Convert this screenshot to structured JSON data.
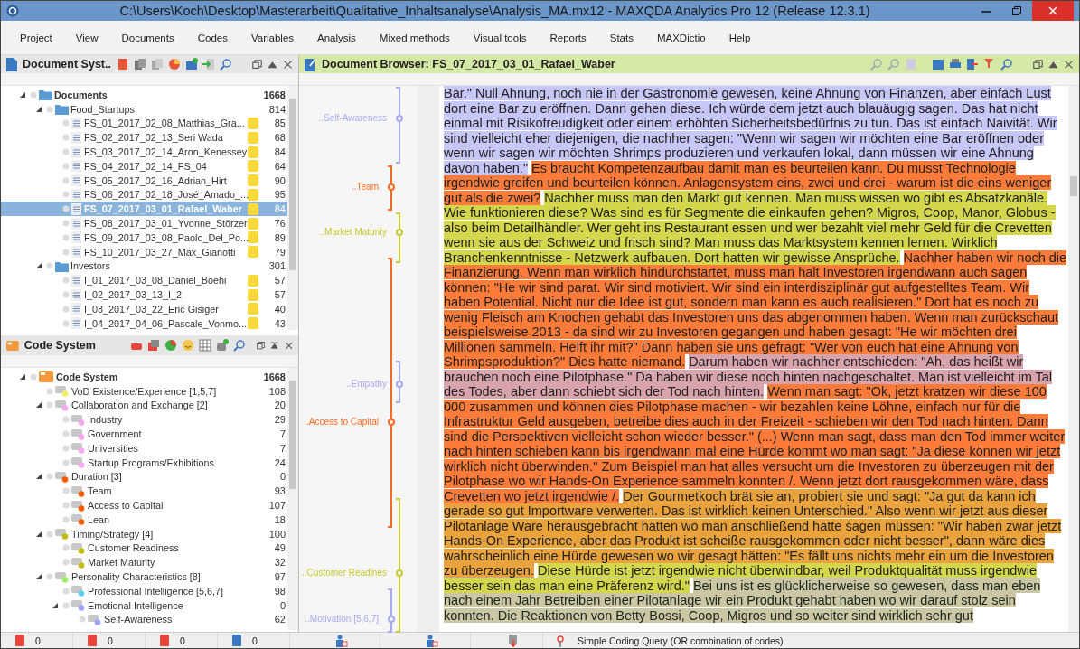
{
  "window": {
    "title": "C:\\Users\\Koch\\Desktop\\Masterarbeit\\Qualitative_Inhaltsanalyse\\Analysis_MA.mx12 - MAXQDA Analytics Pro 12  (Release 12.3.1)"
  },
  "menu": [
    "Project",
    "View",
    "Documents",
    "Codes",
    "Variables",
    "Analysis",
    "Mixed methods",
    "Visual tools",
    "Reports",
    "Stats",
    "MAXDictio",
    "Help"
  ],
  "document_system": {
    "title": "Document Syst..",
    "tree": [
      {
        "kind": "root",
        "label": "Documents",
        "count": "1668",
        "expanded": true,
        "selected": false,
        "children": [
          {
            "kind": "folder",
            "label": "Food_Startups",
            "count": "814",
            "expanded": true,
            "selected": false,
            "children": [
              {
                "kind": "document",
                "label": "FS_01_2017_02_08_Matthias_Gra...",
                "count": "85",
                "selected": false
              },
              {
                "kind": "document",
                "label": "FS_02_2017_02_13_Seri Wada",
                "count": "68",
                "selected": false
              },
              {
                "kind": "document",
                "label": "FS_03_2017_02_14_Aron_Kenessey",
                "count": "84",
                "selected": false
              },
              {
                "kind": "document",
                "label": "FS_04_2017_02_14_FS_04",
                "count": "64",
                "selected": false
              },
              {
                "kind": "document",
                "label": "FS_05_2017_02_16_Adrian_Hirt",
                "count": "90",
                "selected": false
              },
              {
                "kind": "document",
                "label": "FS_06_2017_02_18_José_Amado_...",
                "count": "95",
                "selected": false
              },
              {
                "kind": "document",
                "label": "FS_07_2017_03_01_Rafael_Waber",
                "count": "84",
                "selected": true
              },
              {
                "kind": "document",
                "label": "FS_08_2017_03_01_Yvonne_Störzer",
                "count": "76",
                "selected": false
              },
              {
                "kind": "document",
                "label": "FS_09_2017_03_08_Paolo_Del_Po...",
                "count": "89",
                "selected": false
              },
              {
                "kind": "document",
                "label": "FS_10_2017_03_27_Max_Gianotti",
                "count": "79",
                "selected": false
              }
            ]
          },
          {
            "kind": "folder",
            "label": "Investors",
            "count": "301",
            "expanded": true,
            "selected": false,
            "children": [
              {
                "kind": "document",
                "label": "I_01_2017_03_08_Daniel_Boehi",
                "count": "57",
                "selected": false
              },
              {
                "kind": "document",
                "label": "I_02_2017_03_13_I_2",
                "count": "57",
                "selected": false
              },
              {
                "kind": "document",
                "label": "I_03_2017_03_22_Eric Gisiger",
                "count": "40",
                "selected": false
              },
              {
                "kind": "document",
                "label": "I_04_2017_04_06_Pascale_Vonmo...",
                "count": "43",
                "selected": false
              }
            ]
          }
        ]
      }
    ]
  },
  "code_system": {
    "title": "Code System",
    "tree": [
      {
        "kind": "root",
        "label": "Code System",
        "count": "1668",
        "expanded": true,
        "children": [
          {
            "kind": "code",
            "label": "VoD Existence/Experience [1,5,7]",
            "count": "108",
            "color": "#f3ee70"
          },
          {
            "kind": "code",
            "label": "Collaboration and Exchange [2]",
            "count": "20",
            "color": "#f5a8ee",
            "expanded": true,
            "children": [
              {
                "kind": "code",
                "label": "Industry",
                "count": "29",
                "color": "#f5a8ee"
              },
              {
                "kind": "code",
                "label": "Government",
                "count": "7",
                "color": "#f5a8ee"
              },
              {
                "kind": "code",
                "label": "Universities",
                "count": "7",
                "color": "#f5a8ee"
              },
              {
                "kind": "code",
                "label": "Startup Programs/Exhibitions",
                "count": "24",
                "color": "#f5a8ee"
              }
            ]
          },
          {
            "kind": "code",
            "label": "Duration [3]",
            "count": "0",
            "color": "#ff5a00",
            "expanded": true,
            "children": [
              {
                "kind": "code",
                "label": "Team",
                "count": "93",
                "color": "#ff5a00"
              },
              {
                "kind": "code",
                "label": "Access to Capital",
                "count": "107",
                "color": "#ff5a00"
              },
              {
                "kind": "code",
                "label": "Lean",
                "count": "18",
                "color": "#ff5a00"
              }
            ]
          },
          {
            "kind": "code",
            "label": "Timing/Strategy [4]",
            "count": "100",
            "color": "#c4bc10",
            "expanded": true,
            "children": [
              {
                "kind": "code",
                "label": "Customer Readiness",
                "count": "49",
                "color": "#c4bc10"
              },
              {
                "kind": "code",
                "label": "Market Maturity",
                "count": "32",
                "color": "#c4bc10"
              }
            ]
          },
          {
            "kind": "code",
            "label": "Personality Characteristics [8]",
            "count": "97",
            "color": "#9cf070",
            "expanded": true,
            "children": [
              {
                "kind": "code",
                "label": "Professional Intelligence [5,6,7]",
                "count": "98",
                "color": "#5cd0f5"
              },
              {
                "kind": "code",
                "label": "Emotional Intelligence",
                "count": "0",
                "color": "#a0a0ff",
                "expanded": true,
                "children": [
                  {
                    "kind": "code",
                    "label": "Self-Awareness",
                    "count": "62",
                    "color": "#a0a0ff"
                  }
                ]
              }
            ]
          }
        ]
      }
    ]
  },
  "document_browser": {
    "title": "Document Browser: FS_07_2017_03_01_Rafael_Waber",
    "margin_codes": [
      {
        "label": "..Self-Awareness",
        "color": "#a8a8f0"
      },
      {
        "label": "..Team",
        "color": "#ff6a20"
      },
      {
        "label": "..Market Maturity",
        "color": "#c8c830"
      },
      {
        "label": "..Empathy",
        "color": "#a8a8f0"
      },
      {
        "label": "..Access to Capital",
        "color": "#ff6a20"
      },
      {
        "label": "..Customer Readines",
        "color": "#c8c830"
      },
      {
        "label": "..Motivation [5,6,7]",
        "color": "#a8a8f0"
      }
    ],
    "segments": [
      {
        "text": "Bar.\" Null Ahnung, noch nie in der Gastronomie gewesen, keine Ahnung von Finanzen, aber einfach Lust dort eine Bar zu eröffnen. Dann gehen diese. Ich würde dem jetzt auch blauäugig sagen. Das hat nicht einmal mit Risikofreudigkeit oder einem erhöhten Sicherheitsbedürfnis zu tun. Das ist einfach Naivität. Wir sind vielleicht eher diejenigen, die nachher sagen: \"Wenn wir sagen wir möchten eine Bar eröffnen oder wenn wir sagen wir möchten Shrimps produzieren und verkaufen lokal, dann müssen wir eine Ahnung davon haben.\"",
        "color": "#c6c6f7"
      },
      {
        "text": "Es braucht Kompetenzaufbau damit man es beurteilen kann. Du musst Technologie irgendwie greifen und beurteilen können. Anlagensystem eins, zwei und drei - warum ist die eins weniger gut als die zwei?",
        "color": "#ff7b3a"
      },
      {
        "text": "Nachher muss man den Markt gut kennen. Man muss wissen wo gibt es Absatzkanäle. Wie funktionieren diese? Was sind es für Segmente die einkaufen gehen? Migros, Coop, Manor, Globus - also beim Detailhändler. Wer geht ins Restaurant essen und wer bezahlt viel mehr Geld für die Crevetten wenn sie aus der Schweiz und frisch sind? Man muss das Marktsystem kennen lernen. Wirklich Branchenkenntnisse - Netzwerk aufbauen. Dort hatten wir gewisse Ansprüche.",
        "color": "#d4d74c"
      },
      {
        "text": "Nachher haben wir noch die Finanzierung. Wenn man wirklich hindurchstartet, muss man halt Investoren irgendwann auch sagen können: \"He wir sind parat. Wir sind motiviert. Wir sind ein interdisziplinär gut aufgestelltes Team. Wir haben Potential. Nicht nur die Idee ist gut, sondern man kann es auch realisieren.\" Dort hat es noch zu wenig Fleisch am Knochen gehabt das Investoren uns das abgenommen haben. Wenn man zurückschaut beispielsweise 2013 - da sind wir zu Investoren gegangen und haben gesagt: \"He wir möchten drei Millionen sammeln. Helft ihr mit?\" Dann haben sie uns gefragt: \"Wer von euch hat eine Ahnung von Shrimpsproduktion?\" Dies hatte niemand.",
        "color": "#ff7b3a"
      },
      {
        "text": "Darum haben wir nachher entschieden: \"Ah, das heißt wir brauchen noch eine Pilotphase.\" Da haben wir diese noch hinten nachgeschaltet. Man ist vielleicht im Tal des Todes, aber dann schiebt sich der Tod nach hinten.",
        "color": "#d9a3ad"
      },
      {
        "text": "Wenn man sagt: \"Ok, jetzt kratzen wir diese 100 000 zusammen und können dies Pilotphase machen - wir bezahlen keine Löhne, einfach nur für die Infrastruktur Geld ausgeben, betreibe dies auch in der Freizeit - schieben wir den Tod nach hinten. Dann sind die Perspektiven vielleicht schon wieder besser.\" (...) Wenn man sagt, dass man den Tod immer weiter nach hinten schieben kann bis irgendwann mal eine Hürde kommt wo man sagt: \"Ja diese können wir jetzt wirklich nicht überwinden.\" Zum Beispiel man hat alles versucht um die Investoren zu überzeugen mit der Pilotphase wo wir Hands-On Experience sammeln konnten /. Wenn jetzt dort rausgekommen wäre, dass Crevetten wo jetzt irgendwie /.",
        "color": "#ff7b3a"
      },
      {
        "text": "Der Gourmetkoch brät sie an, probiert sie und sagt: \"Ja gut da kann ich gerade so gut Importware verwerten. Das ist wirklich keinen Unterschied.\" Also wenn wir jetzt aus dieser Pilotanlage Ware herausgebracht hätten wo man anschließend hätte sagen müssen: \"Wir haben zwar jetzt Hands-On Experience, aber das Produkt ist scheiße rausgekommen oder nicht besser\", dann wäre dies wahrscheinlich eine Hürde gewesen wo wir gesagt hätten: \"Es fällt uns nichts mehr ein um die Investoren zu überzeugen.",
        "color": "#eaa33c"
      },
      {
        "text": "Diese Hürde ist jetzt irgendwie nicht überwindbar, weil Produktqualität muss irgendwie besser sein das man eine Präferenz wird.\"",
        "color": "#d4d74c"
      },
      {
        "text": "Bei uns ist es glücklicherweise so gewesen, dass man eben nach einem Jahr Betreiben einer Pilotanlage wir ein Produkt gehabt haben wo wir darauf stolz sein konnten. Die Reaktionen von Betty Bossi, Coop, Migros und so weiter sind wirklich sehr gut",
        "color": "#c9c8a2"
      }
    ]
  },
  "status_bar": {
    "counts": [
      "0",
      "0",
      "0",
      "0"
    ],
    "query": "Simple Coding Query (OR combination of codes)"
  }
}
